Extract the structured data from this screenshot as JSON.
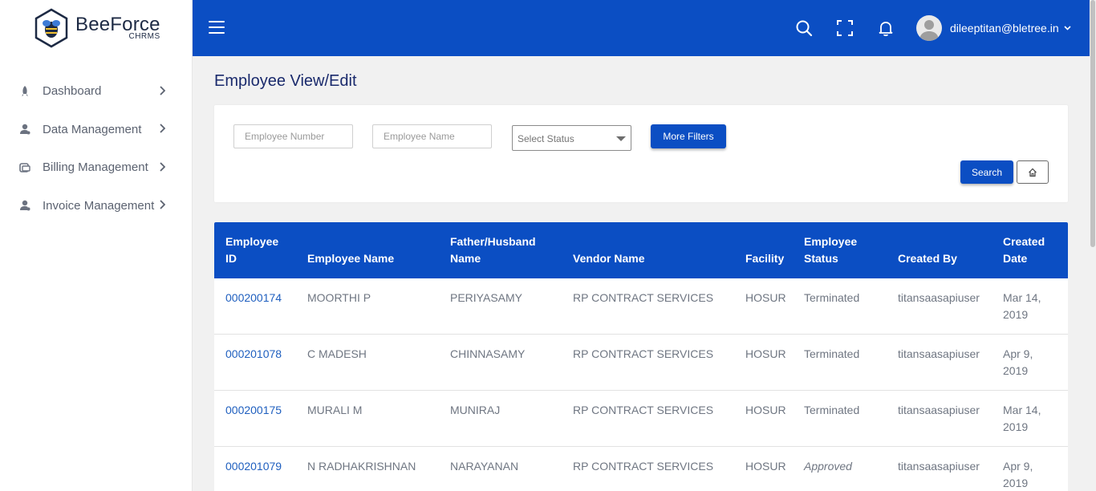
{
  "brand": {
    "name": "BeeForce",
    "sub": "CHRMS"
  },
  "sidebar": {
    "items": [
      {
        "label": "Dashboard",
        "icon": "rocket-icon"
      },
      {
        "label": "Data Management",
        "icon": "user-gear-icon"
      },
      {
        "label": "Billing Management",
        "icon": "billing-icon"
      },
      {
        "label": "Invoice Management",
        "icon": "user-gear-icon"
      }
    ]
  },
  "header": {
    "user_email": "dileeptitan@bletree.in",
    "icons": [
      "menu-icon",
      "search-icon",
      "fullscreen-icon",
      "bell-icon",
      "avatar",
      "chevron-down-icon"
    ]
  },
  "page": {
    "title": "Employee View/Edit"
  },
  "filters": {
    "employee_number_placeholder": "Employee Number",
    "employee_name_placeholder": "Employee Name",
    "status_placeholder": "Select Status",
    "more_filters_label": "More Filters",
    "search_label": "Search"
  },
  "table": {
    "headers": [
      "Employee ID",
      "Employee Name",
      "Father/Husband Name",
      "Vendor Name",
      "Facility",
      "Employee Status",
      "Created By",
      "Created Date"
    ],
    "rows": [
      {
        "id": "000200174",
        "name": "MOORTHI P",
        "father": "PERIYASAMY",
        "vendor": "RP CONTRACT SERVICES",
        "facility": "HOSUR",
        "status": "Terminated",
        "created_by": "titansaasapiuser",
        "date1": "Mar 14,",
        "date2": "2019"
      },
      {
        "id": "000201078",
        "name": "C MADESH",
        "father": "CHINNASAMY",
        "vendor": "RP CONTRACT SERVICES",
        "facility": "HOSUR",
        "status": "Terminated",
        "created_by": "titansaasapiuser",
        "date1": "Apr 9,",
        "date2": "2019"
      },
      {
        "id": "000200175",
        "name": "MURALI M",
        "father": "MUNIRAJ",
        "vendor": "RP CONTRACT SERVICES",
        "facility": "HOSUR",
        "status": "Terminated",
        "created_by": "titansaasapiuser",
        "date1": "Mar 14,",
        "date2": "2019"
      },
      {
        "id": "000201079",
        "name": "N RADHAKRISHNAN",
        "father": "NARAYANAN",
        "vendor": "RP CONTRACT SERVICES",
        "facility": "HOSUR",
        "status": "Approved",
        "created_by": "titansaasapiuser",
        "date1": "Apr 9,",
        "date2": "2019"
      }
    ]
  },
  "colors": {
    "primary": "#0b4ec3",
    "link": "#1f5fbf",
    "title": "#1a2a6c"
  }
}
